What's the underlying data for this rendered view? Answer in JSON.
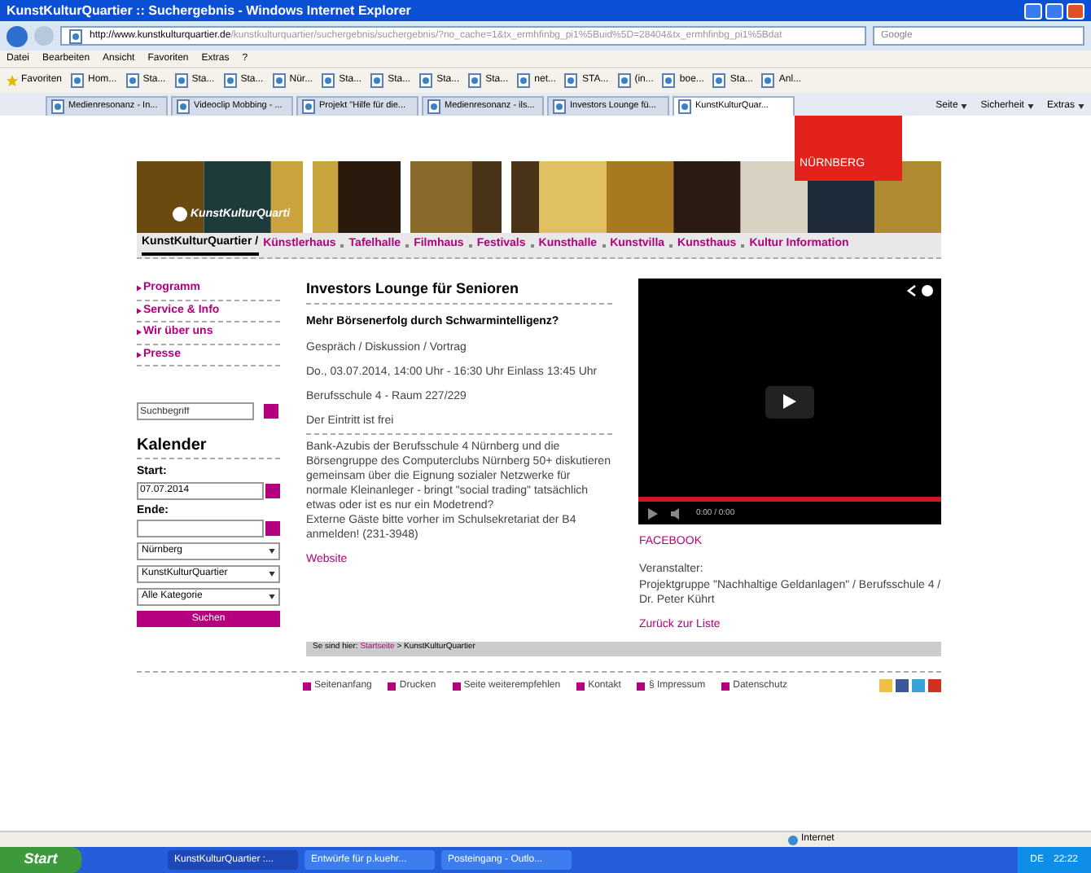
{
  "window": {
    "title": "KunstKulturQuartier :: Suchergebnis - Windows Internet Explorer"
  },
  "address_bar": {
    "url_host": "http://www.kunstkulturquartier.de",
    "url_path": "/kunstkulturquartier/suchergebnis/suchergebnis/?no_cache=1&tx_ermhfinbg_pi1%5Buid%5D=28404&tx_ermhfinbg_pi1%5Bdat",
    "search_placeholder": "Google"
  },
  "menu": [
    "Datei",
    "Bearbeiten",
    "Ansicht",
    "Favoriten",
    "Extras",
    "?"
  ],
  "favorites": {
    "label": "Favoriten",
    "links": [
      "Hom...",
      "Sta...",
      "Sta...",
      "Sta...",
      "Nür...",
      "Sta...",
      "Sta...",
      "Sta...",
      "Sta...",
      "net...",
      "STA...",
      "(in...",
      "boe...",
      "Sta...",
      "Anl..."
    ]
  },
  "tabs": [
    {
      "label": "Medienresonanz - In...",
      "selected": false
    },
    {
      "label": "Videoclip Mobbing - ...",
      "selected": false
    },
    {
      "label": "Projekt \"Hilfe für die...",
      "selected": false
    },
    {
      "label": "Medienresonanz - ils...",
      "selected": false
    },
    {
      "label": "Investors Lounge fü...",
      "selected": false
    },
    {
      "label": "KunstKulturQuar...",
      "selected": true
    }
  ],
  "command_bar": [
    "Seite",
    "Sicherheit",
    "Extras"
  ],
  "site": {
    "city_logo": "NÜRNBERG",
    "brand": "KunstKulturQuarti",
    "nav_home": "KunstKulturQuartier /",
    "nav": [
      "Künstlerhaus",
      "Tafelhalle",
      "Filmhaus",
      "Festivals",
      "Kunsthalle",
      "Kunstvilla",
      "Kunsthaus",
      "Kultur Information"
    ]
  },
  "sidebar": {
    "links": [
      "Programm",
      "Service & Info",
      "Wir über uns",
      "Presse"
    ],
    "search_placeholder": "Suchbegriff",
    "calendar": {
      "heading": "Kalender",
      "start_label": "Start:",
      "start_value": "07.07.2014",
      "end_label": "Ende:",
      "selects": [
        "Nürnberg",
        "KunstKulturQuartier",
        "Alle Kategorie"
      ],
      "button": "Suchen"
    }
  },
  "article": {
    "title": "Investors Lounge für Senioren",
    "subtitle": "Mehr Börsenerfolg durch Schwarmintelligenz?",
    "details": [
      "Gespräch / Diskussion / Vortrag",
      "Do., 03.07.2014, 14:00 Uhr  - 16:30 Uhr Einlass 13:45 Uhr",
      "Berufsschule 4 - Raum 227/229",
      "Der Eintritt ist frei"
    ],
    "body": [
      "Bank-Azubis der Berufsschule 4 Nürnberg und die Börsengruppe des Computerclubs Nürnberg 50+ diskutieren gemeinsam über die Eignung sozialer Netzwerke für normale Kleinanleger - bringt \"social trading\" tatsächlich etwas oder ist es nur ein Modetrend?",
      "Externe Gäste bitte vorher im Schulsekretariat der B4 anmelden! (231-3948)"
    ],
    "website": "Website"
  },
  "video": {
    "time": "0:00 / 0:00",
    "level": 1
  },
  "aside": {
    "facebook": "FACEBOOK",
    "organizer_label": "Veranstalter:",
    "organizer": "Projektgruppe \"Nachhaltige Geldanlagen\" / Berufsschule 4 / Dr. Peter Kührt",
    "back": "Zurück zur Liste"
  },
  "breadcrumb": {
    "prefix": "Se sind hier:",
    "link": "Startseite",
    "rest": "> KunstKulturQuartier"
  },
  "footer": [
    "Seitenanfang",
    "Drucken",
    "Seite weiterempfehlen",
    "Kontakt",
    "§ Impressum",
    "Datenschutz"
  ],
  "status_bar": {
    "zone": "Internet"
  },
  "taskbar": {
    "start": "Start",
    "tasks": [
      "KunstKulturQuartier :...",
      "Entwürfe für p.kuehr...",
      "Posteingang - Outlo..."
    ],
    "language": "DE",
    "time": "22:22"
  }
}
